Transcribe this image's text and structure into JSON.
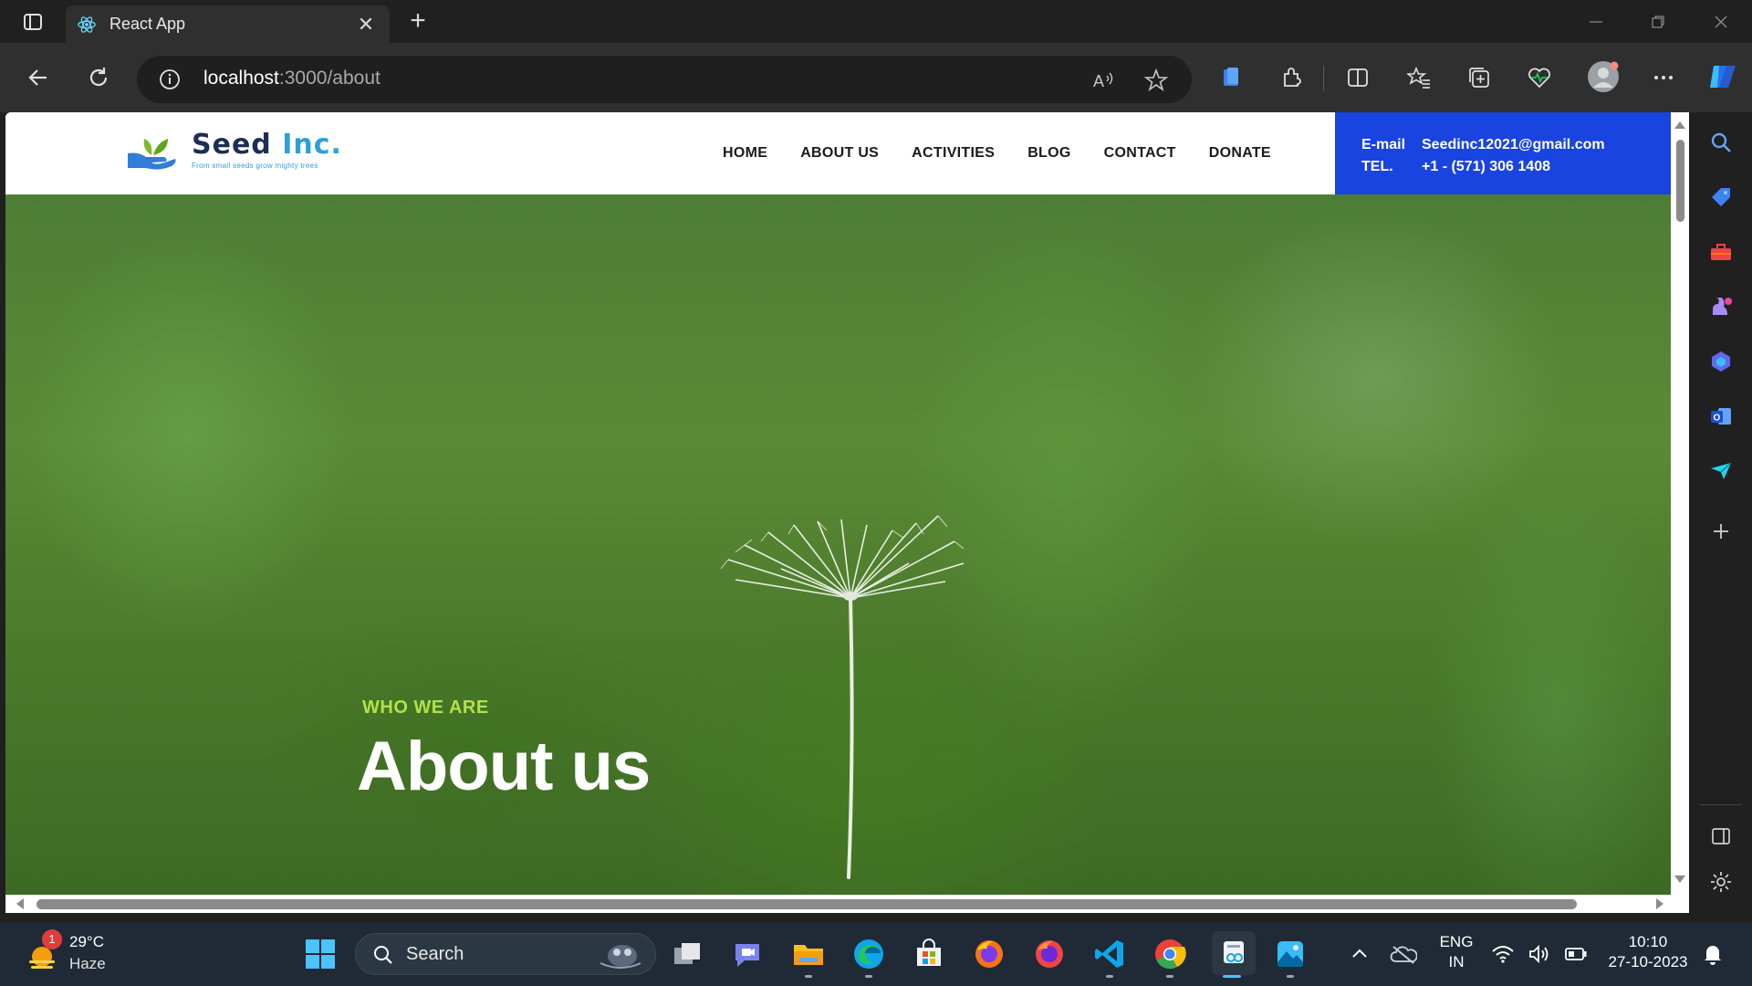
{
  "browser": {
    "tab_title": "React App",
    "url_host": "localhost",
    "url_path": ":3000/about"
  },
  "site": {
    "logo_name_main": "Seed",
    "logo_name_accent": " Inc.",
    "logo_tagline": "From small seeds grow mighty trees",
    "nav": [
      "HOME",
      "ABOUT US",
      "ACTIVITIES",
      "BLOG",
      "CONTACT",
      "DONATE"
    ],
    "contact": {
      "email_label": "E-mail",
      "email_value": "Seedinc12021@gmail.com",
      "tel_label": "TEL.",
      "tel_value": "+1 - (571) 306 1408"
    },
    "hero": {
      "kicker": "WHO WE ARE",
      "title": "About us"
    }
  },
  "taskbar": {
    "weather_temp": "29°C",
    "weather_condition": "Haze",
    "weather_badge": "1",
    "search_label": "Search",
    "lang_line1": "ENG",
    "lang_line2": "IN",
    "time": "10:10",
    "date": "27-10-2023"
  },
  "colors": {
    "contact_box": "#1a44e0",
    "kicker": "#b4e04a",
    "logo_navy": "#1c2e58",
    "logo_blue": "#2f9fd8"
  },
  "icons": {
    "browser": [
      "tab-actions-icon",
      "react-favicon-icon",
      "close-icon",
      "plus-icon",
      "back-arrow-icon",
      "refresh-icon",
      "info-icon",
      "read-aloud-icon",
      "star-icon",
      "office-icon",
      "extensions-icon",
      "split-screen-icon",
      "favorites-icon",
      "collections-icon",
      "health-icon",
      "profile-icon",
      "more-icon",
      "copilot-icon"
    ],
    "sidebar": [
      "search-icon",
      "tag-icon",
      "toolbox-icon",
      "games-icon",
      "m365-icon",
      "outlook-icon",
      "send-icon",
      "add-icon",
      "sidebar-toggle-icon",
      "settings-icon"
    ]
  }
}
